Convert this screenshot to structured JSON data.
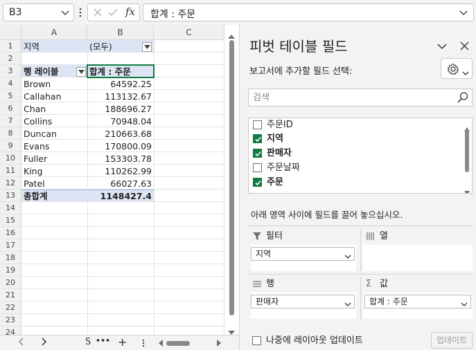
{
  "formula_bar": {
    "name_box": "B3",
    "fx_label": "fx",
    "formula": "합계 : 주문"
  },
  "grid": {
    "columns": [
      "A",
      "B",
      "C"
    ],
    "rows": [
      "1",
      "2",
      "3",
      "4",
      "5",
      "6",
      "7",
      "8",
      "9",
      "10",
      "11",
      "12",
      "13",
      "14",
      "15",
      "16",
      "17",
      "18",
      "19",
      "20",
      "21",
      "22",
      "23",
      "24"
    ],
    "filter_label": "지역",
    "filter_value": "(모두)",
    "row_labels_header": "행 레이블",
    "sum_header": "합계 : 주문",
    "data_rows": [
      {
        "name": "Brown",
        "value": "64592.25"
      },
      {
        "name": "Callahan",
        "value": "113132.67"
      },
      {
        "name": "Chan",
        "value": "188696.27"
      },
      {
        "name": "Collins",
        "value": "70948.04"
      },
      {
        "name": "Duncan",
        "value": "210663.68"
      },
      {
        "name": "Evans",
        "value": "170800.09"
      },
      {
        "name": "Fuller",
        "value": "153303.78"
      },
      {
        "name": "King",
        "value": "110262.99"
      },
      {
        "name": "Patel",
        "value": "66027.63"
      }
    ],
    "grand_total_label": "총합계",
    "grand_total_value": "1148427.4"
  },
  "sheet_tabs": {
    "tab_label": "S",
    "more": "•••",
    "add": "+"
  },
  "pivot_pane": {
    "title": "피벗 테이블 필드",
    "report_label": "보고서에 추가할 필드 선택:",
    "search_placeholder": "검색",
    "fields": [
      {
        "label": "주문ID",
        "checked": false
      },
      {
        "label": "지역",
        "checked": true
      },
      {
        "label": "판매자",
        "checked": true
      },
      {
        "label": "주문날짜",
        "checked": false
      },
      {
        "label": "주문",
        "checked": true
      }
    ],
    "drag_hint": "아래 영역 사이에 필드를 끌어 놓으십시오.",
    "areas": {
      "filters": {
        "title": "필터",
        "chip": "지역"
      },
      "columns": {
        "title": "열"
      },
      "rows": {
        "title": "행",
        "chip": "판매자"
      },
      "values": {
        "title": "값",
        "chip": "합계 : 주문"
      }
    },
    "defer_label": "나중에 레이아웃 업데이트",
    "update_button": "업데이트"
  },
  "colors": {
    "accent": "#107c41",
    "pivot_header_band": "#dde5f4"
  }
}
